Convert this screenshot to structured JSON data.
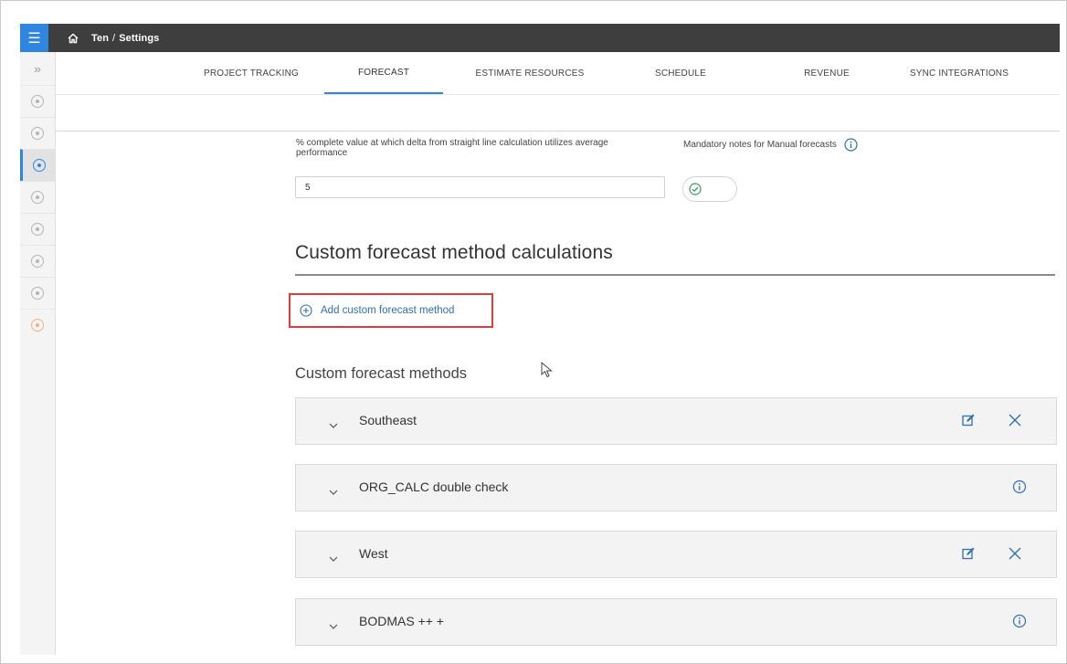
{
  "breadcrumb": {
    "project": "Ten",
    "separator": "/",
    "page": "Settings"
  },
  "tabs": [
    {
      "label": "PROJECT TRACKING"
    },
    {
      "label": "FORECAST"
    },
    {
      "label": "ESTIMATE RESOURCES"
    },
    {
      "label": "SCHEDULE"
    },
    {
      "label": "REVENUE"
    },
    {
      "label": "SYNC INTEGRATIONS"
    }
  ],
  "active_tab": "FORECAST",
  "settings": {
    "delta_label": "% complete value at which delta from straight line calculation utilizes average performance",
    "delta_value": "5",
    "mandatory_notes_label": "Mandatory notes for Manual forecasts",
    "mandatory_notes_enabled": true
  },
  "custom_calc": {
    "title": "Custom forecast method calculations",
    "add_label": "Add custom forecast method"
  },
  "methods_section": {
    "title": "Custom forecast methods",
    "items": [
      {
        "name": "Southeast",
        "actions": [
          "edit-icon",
          "close-icon"
        ]
      },
      {
        "name": "ORG_CALC double check",
        "actions": [
          "info-icon"
        ]
      },
      {
        "name": "West",
        "actions": [
          "edit-icon",
          "close-icon"
        ]
      },
      {
        "name": "BODMAS ++ +",
        "actions": [
          "info-icon"
        ]
      }
    ]
  },
  "colors": {
    "accent": "#2f86e0",
    "topbar": "#3e3e3e",
    "highlight": "#e03c3c",
    "success": "#3a9a5a"
  }
}
